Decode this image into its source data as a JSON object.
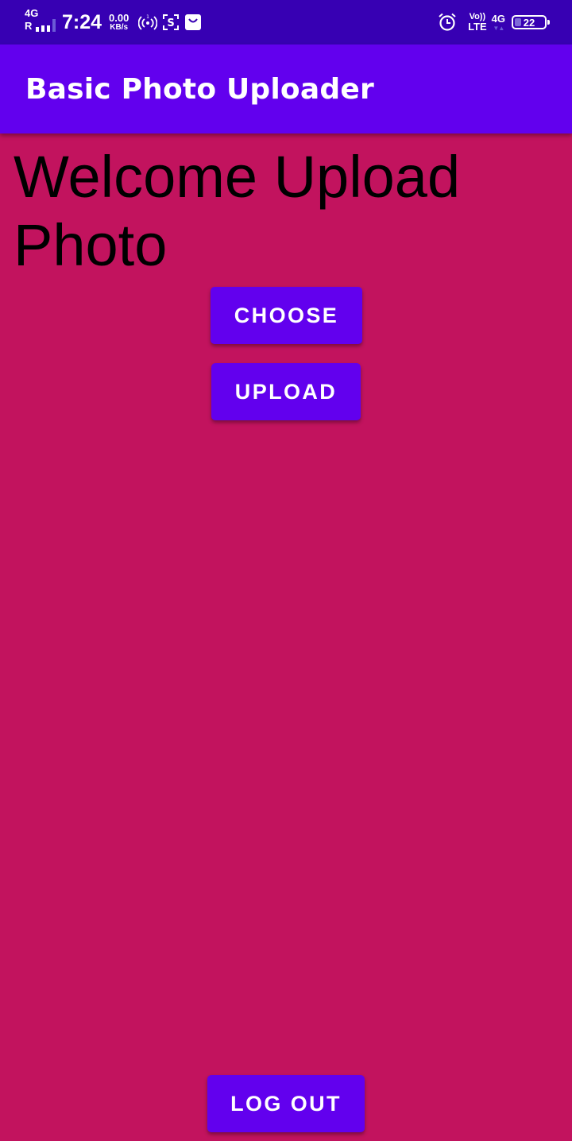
{
  "status_bar": {
    "network_type": "4G",
    "roaming": "R",
    "time": "7:24",
    "speed_value": "0.00",
    "speed_unit": "KB/s",
    "volte_top": "Vo))",
    "volte_bottom": "LTE",
    "network_type_right": "4G",
    "battery_level": "22",
    "battery_fraction": 0.22,
    "icons": [
      "signal-bars-icon",
      "hotspot-icon",
      "screenshot-icon",
      "shopping-bag-icon",
      "alarm-clock-icon",
      "data-arrows-icon",
      "battery-icon"
    ]
  },
  "app_bar": {
    "title": "Basic Photo Uploader"
  },
  "main": {
    "welcome_text": "Welcome Upload Photo",
    "choose_label": "CHOOSE",
    "upload_label": "UPLOAD",
    "logout_label": "LOG OUT"
  },
  "colors": {
    "status_bar": "#3700b3",
    "app_bar": "#6200ee",
    "background": "#c2135e",
    "button": "#6200ee",
    "button_text": "#ffffff",
    "welcome_text": "#000000"
  }
}
